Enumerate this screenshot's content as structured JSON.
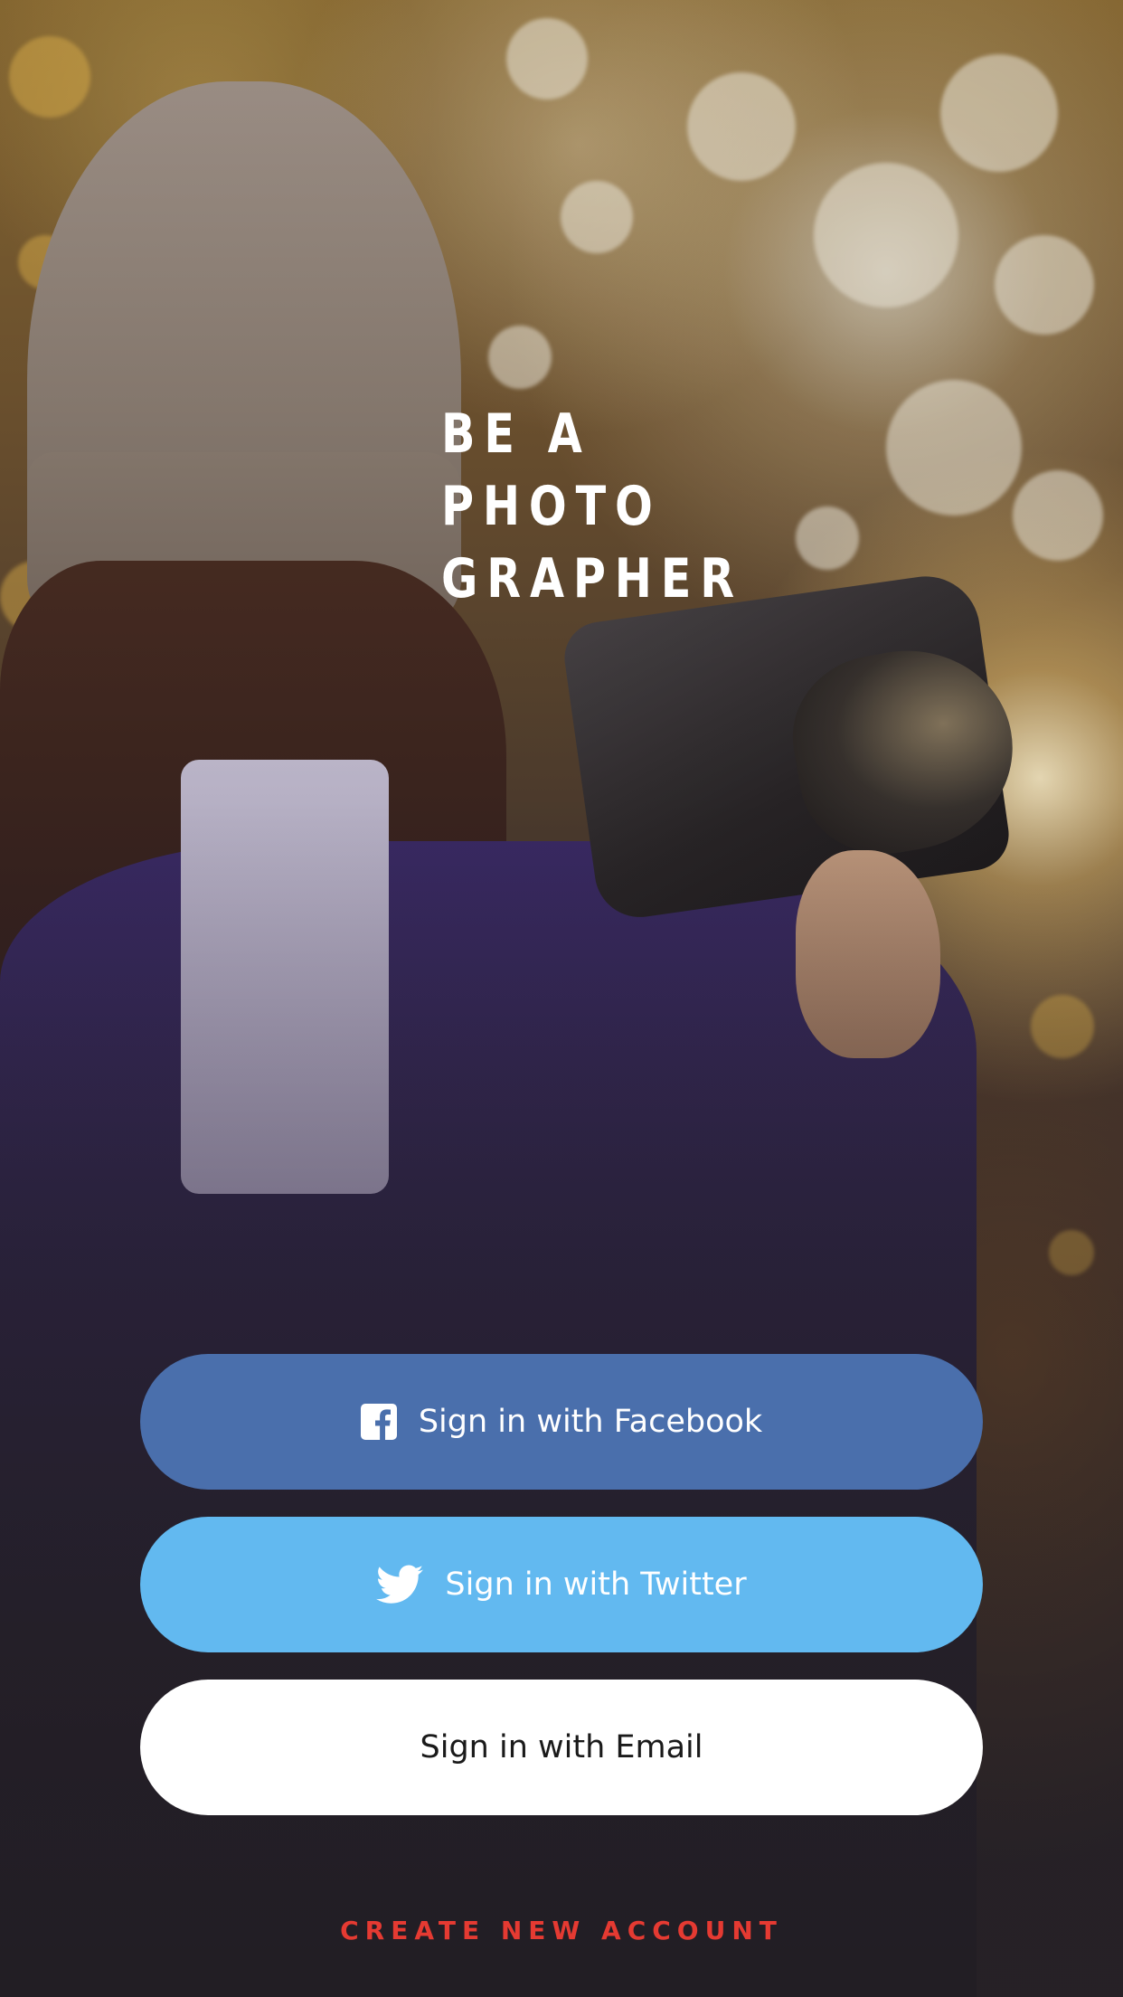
{
  "headline": {
    "line1": "BE A",
    "line2": "PHOTO",
    "line3": "GRAPHER"
  },
  "buttons": {
    "facebook": {
      "label": "Sign in with Facebook",
      "icon": "facebook-icon",
      "color": "#4a6fac"
    },
    "twitter": {
      "label": "Sign in with Twitter",
      "icon": "twitter-icon",
      "color": "#62b9f0"
    },
    "email": {
      "label": "Sign in with Email",
      "color": "#ffffff"
    }
  },
  "create_account": {
    "label": "CREATE NEW ACCOUNT",
    "color": "#e53a32"
  }
}
